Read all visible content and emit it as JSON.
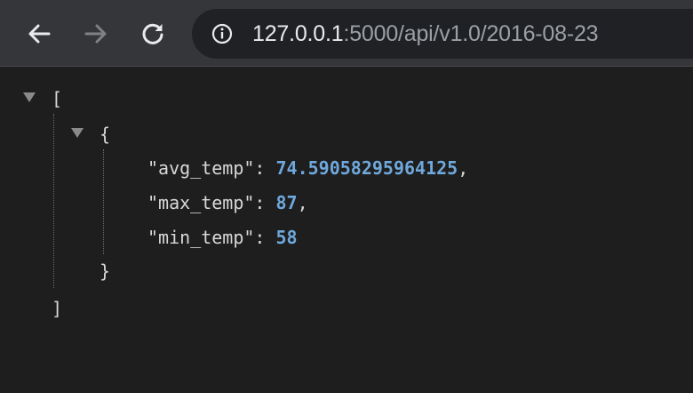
{
  "browser": {
    "url_host": "127.0.0.1",
    "url_rest": ":5000/api/v1.0/2016-08-23",
    "back_icon": "arrow-left-icon",
    "forward_icon": "arrow-right-icon",
    "reload_icon": "reload-icon",
    "site_info_icon": "info-circle-icon"
  },
  "json": {
    "open_array": "[",
    "close_array": "]",
    "open_object": "{",
    "close_object": "}",
    "entries": [
      {
        "key": "\"avg_temp\"",
        "value": "74.59058295964125",
        "comma": ","
      },
      {
        "key": "\"max_temp\"",
        "value": "87",
        "comma": ","
      },
      {
        "key": "\"min_temp\"",
        "value": "58",
        "comma": ""
      }
    ],
    "colon": ": ",
    "colors": {
      "number": "#6fa8dc",
      "text": "#d8d8d8",
      "background": "#1e1e1e"
    }
  }
}
